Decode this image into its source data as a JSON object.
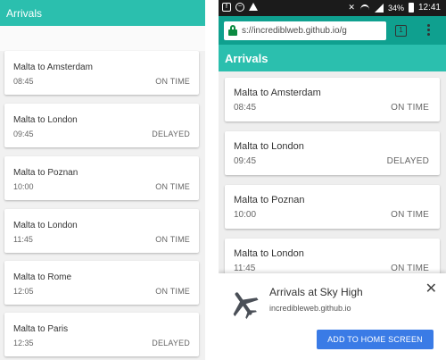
{
  "left_screen": {
    "header_title": "Arrivals",
    "flights": [
      {
        "route": "Malta to Amsterdam",
        "time": "08:45",
        "status": "ON TIME"
      },
      {
        "route": "Malta to London",
        "time": "09:45",
        "status": "DELAYED"
      },
      {
        "route": "Malta to Poznan",
        "time": "10:00",
        "status": "ON TIME"
      },
      {
        "route": "Malta to London",
        "time": "11:45",
        "status": "ON TIME"
      },
      {
        "route": "Malta to Rome",
        "time": "12:05",
        "status": "ON TIME"
      },
      {
        "route": "Malta to Paris",
        "time": "12:35",
        "status": "DELAYED"
      }
    ]
  },
  "right_screen": {
    "status_bar": {
      "left_icons": [
        "notification-f-icon",
        "messenger-icon",
        "warning-icon"
      ],
      "battery": "34%",
      "clock": "12:41"
    },
    "browser": {
      "url": "s://incrediblweb.github.io/g",
      "tab_count": "1"
    },
    "header_title": "Arrivals",
    "flights": [
      {
        "route": "Malta to Amsterdam",
        "time": "08:45",
        "status": "ON TIME"
      },
      {
        "route": "Malta to London",
        "time": "09:45",
        "status": "DELAYED"
      },
      {
        "route": "Malta to Poznan",
        "time": "10:00",
        "status": "ON TIME"
      },
      {
        "route": "Malta to London",
        "time": "11:45",
        "status": "ON TIME"
      }
    ],
    "add_to_home": {
      "title": "Arrivals at Sky High",
      "origin": "incredibleweb.github.io",
      "button_label": "ADD TO HOME SCREEN",
      "icon": "airplane-icon",
      "close_icon": "close-icon"
    }
  },
  "colors": {
    "teal": "#2bbfae",
    "teal_dark": "#0fa08f",
    "button_blue": "#3a7be6"
  }
}
